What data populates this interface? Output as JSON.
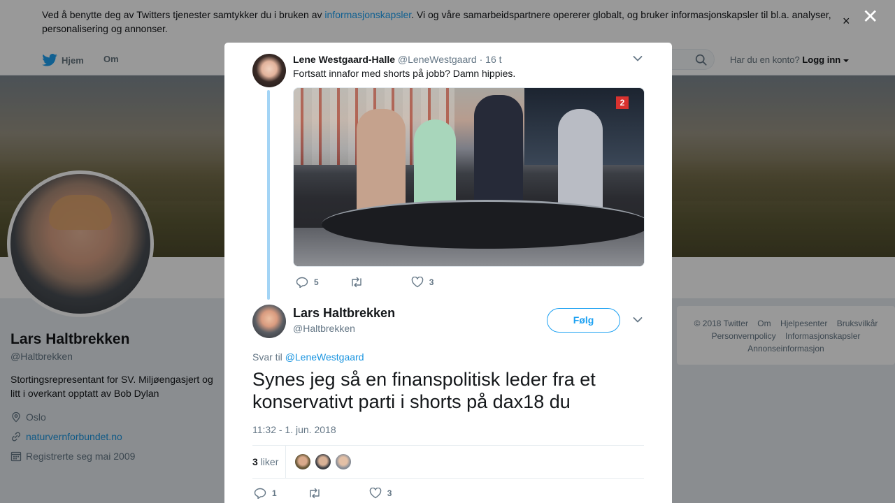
{
  "cookie_banner": {
    "text_before": "Ved å benytte deg av Twitters tjenester samtykker du i bruken av ",
    "link": "informasjonskapsler",
    "text_after": ". Vi og våre samarbeidspartnere opererer globalt, og bruker informasjonskapsler til bl.a. analyser, personalisering og annonser.",
    "close": "×"
  },
  "nav": {
    "home": "Hjem",
    "about": "Om",
    "account_prompt": "Har du en konto?",
    "login": "Logg inn"
  },
  "profile": {
    "name": "Lars Haltbrekken",
    "handle": "@Haltbrekken",
    "bio": "Stortingsrepresentant for SV. Miljøengasjert og litt i overkant opptatt av Bob Dylan",
    "location": "Oslo",
    "website": "naturvernforbundet.no",
    "joined": "Registrerte seg mai 2009"
  },
  "footer": {
    "links": [
      "© 2018 Twitter",
      "Om",
      "Hjelpesenter",
      "Bruksvilkår",
      "Personvernpolicy",
      "Informasjonskapsler",
      "Annonseinformasjon"
    ]
  },
  "overlay_close": "✕",
  "context_tweet": {
    "name": "Lene Westgaard-Halle",
    "handle": "@LeneWestgaard",
    "time": "· 16 t",
    "text": "Fortsatt innafor med shorts på jobb? Damn hippies.",
    "media_logo": "2",
    "replies": "5",
    "retweets": "",
    "likes": "3"
  },
  "main_tweet": {
    "name": "Lars Haltbrekken",
    "handle": "@Haltbrekken",
    "follow": "Følg",
    "reply_prefix": "Svar til",
    "reply_to": "@LeneWestgaard",
    "text": "Synes jeg så en finanspolitisk leder fra et konservativt parti i shorts på dax18 du",
    "timestamp": "11:32 - 1. jun. 2018",
    "likes_count": "3",
    "likes_label": "liker",
    "replies": "1",
    "retweets": "",
    "likes": "3"
  },
  "colors": {
    "twitter_blue": "#1da1f2",
    "link_blue": "#1b95e0",
    "thread_line": "#a3d4f5"
  }
}
